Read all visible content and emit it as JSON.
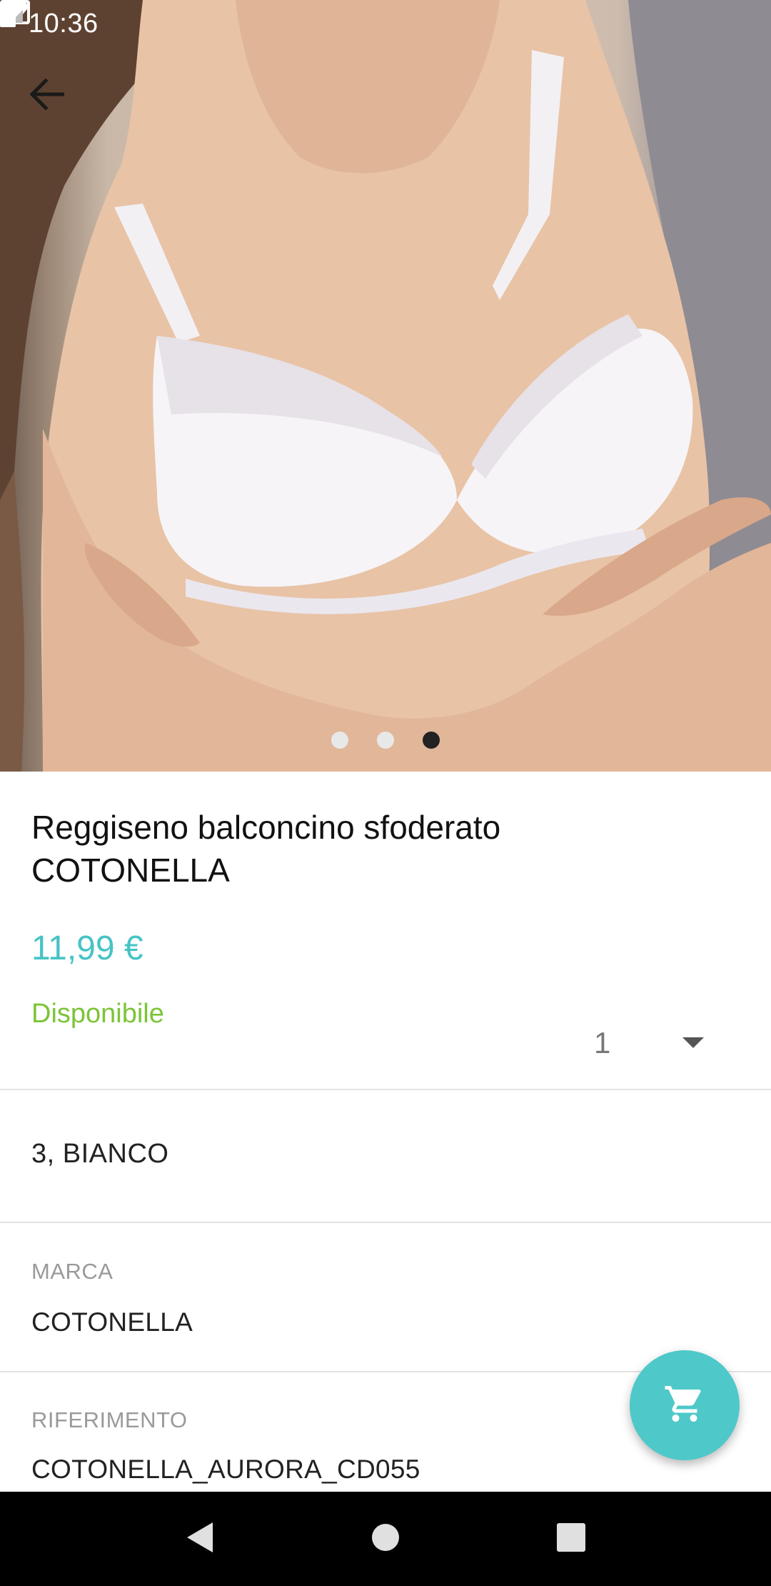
{
  "status_bar": {
    "time": "10:36"
  },
  "hero": {
    "carousel_pages": 3,
    "active_page": 3
  },
  "product": {
    "title": "Reggiseno balconcino sfoderato COTONELLA",
    "price": "11,99 €",
    "availability": "Disponibile",
    "quantity": "1",
    "variant": "3, BIANCO"
  },
  "details": [
    {
      "label": "MARCA",
      "value": "COTONELLA"
    },
    {
      "label": "RIFERIMENTO",
      "value": "COTONELLA_AURORA_CD055"
    }
  ],
  "colors": {
    "accent": "#46c3c6",
    "available": "#7cc437",
    "fab": "#4ec8c8"
  },
  "icons": {
    "back": "arrow-back-icon",
    "cart": "shopping-cart-icon",
    "mail": "mail-icon",
    "wifi": "wifi-icon",
    "signal": "signal-icon",
    "battery": "battery-icon"
  }
}
